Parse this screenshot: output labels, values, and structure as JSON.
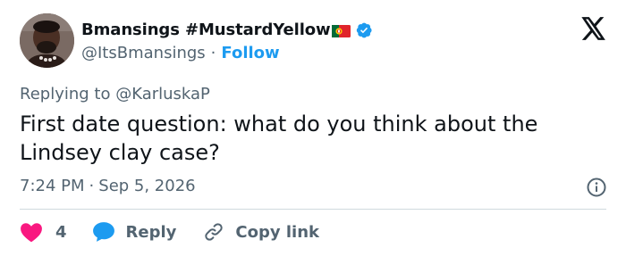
{
  "author": {
    "display_name": "Bmansings #MustardYellow",
    "handle": "@ItsBmansings",
    "follow_label": "Follow",
    "separator": "·",
    "verified": true,
    "flag": "portugal-flag-emoji"
  },
  "reply_to": "Replying to @KarluskaP",
  "tweet": {
    "text": "First date question: what do you think about the Lindsey clay case?",
    "time": "7:24 PM",
    "date": "Sep 5, 2026",
    "separator": "·"
  },
  "actions": {
    "like_count": "4",
    "reply_label": "Reply",
    "copy_label": "Copy link"
  },
  "colors": {
    "accent": "#1d9bf0",
    "like": "#f91880",
    "muted": "#536471",
    "text": "#0f1419",
    "divider": "#cfd9de"
  },
  "icons": [
    "x-logo-icon",
    "verified-badge-icon",
    "info-icon",
    "heart-icon",
    "reply-bubble-icon",
    "link-icon"
  ]
}
